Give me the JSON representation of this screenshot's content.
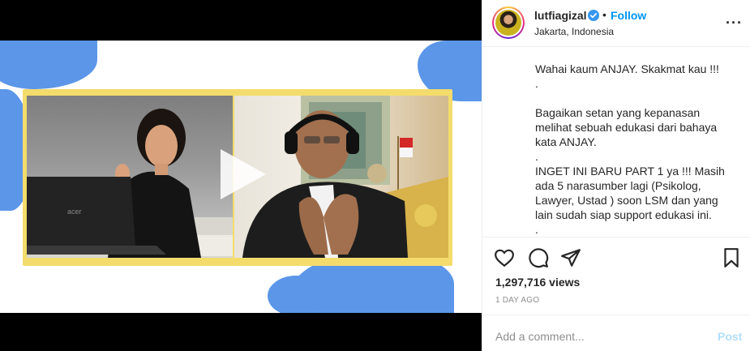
{
  "post": {
    "username": "lutfiagizal",
    "follow_label": "Follow",
    "separator": "•",
    "location": "Jakarta, Indonesia",
    "more_label": "···",
    "caption_lines": [
      "Wahai kaum ANJAY. Skakmat kau !!!",
      ".",
      "",
      "Bagaikan setan yang kepanasan melihat sebuah edukasi dari bahaya kata ANJAY.",
      ".",
      "INGET INI BARU PART 1 ya !!! Masih ada 5 narasumber lagi (Psikolog, Lawyer, Ustad ) soon LSM dan yang lain sudah siap support edukasi ini.",
      "."
    ],
    "views": "1,297,716 views",
    "time_ago": "1 DAY AGO",
    "comment_placeholder": "Add a comment...",
    "post_label": "Post",
    "laptop_brand": "acer"
  },
  "icons": {
    "verified": "verified-badge-icon",
    "like": "heart-icon",
    "comment": "comment-bubble-icon",
    "share": "paper-plane-icon",
    "save": "bookmark-icon",
    "play": "play-icon"
  },
  "colors": {
    "accent_blue": "#0095f6",
    "post_disabled": "#b2dffc",
    "frame_yellow": "#f3dc6c",
    "splash_blue": "#5b96e8"
  }
}
